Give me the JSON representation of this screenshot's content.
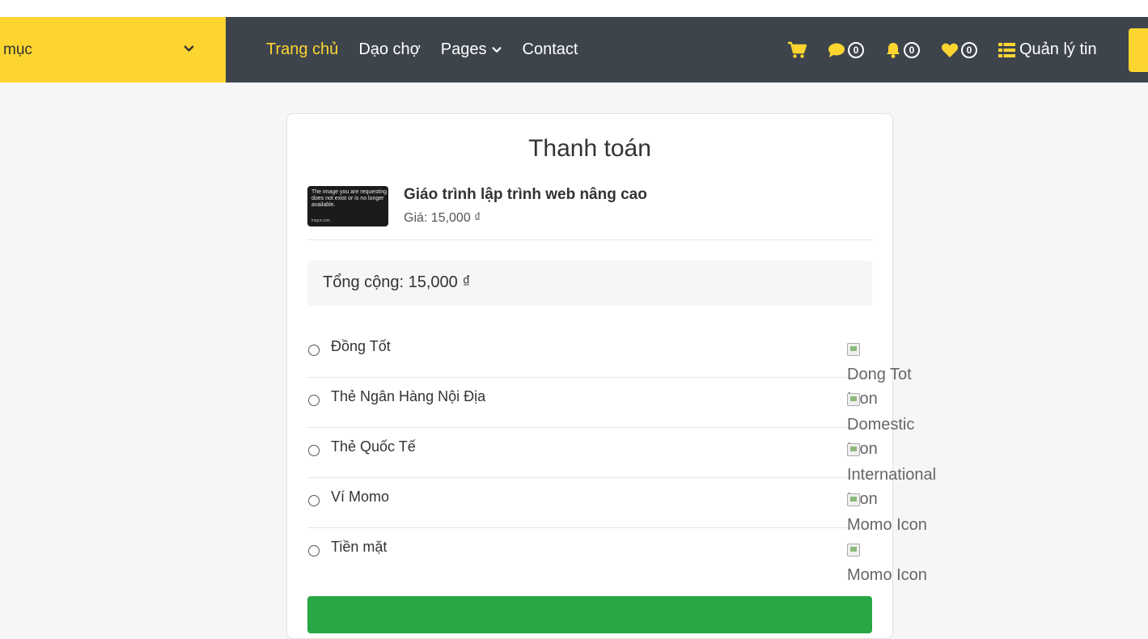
{
  "header": {
    "category_label": "mục",
    "nav": [
      {
        "label": "Trang chủ",
        "active": true
      },
      {
        "label": "Dạo chợ",
        "active": false
      },
      {
        "label": "Pages",
        "active": false,
        "has_dropdown": true
      },
      {
        "label": "Contact",
        "active": false
      }
    ],
    "counts": {
      "messages": "0",
      "notifications": "0",
      "favorites": "0"
    },
    "manage_label": "Quản lý tin"
  },
  "checkout": {
    "title": "Thanh toán",
    "product": {
      "placeholder_text": "The image you are requesting does not exist or is no longer available.",
      "placeholder_site": "imgur.com",
      "name": "Giáo trình lập trình web nâng cao",
      "price": "Giá: 15,000 ₫"
    },
    "total": "Tổng cộng: 15,000 ₫",
    "methods": [
      {
        "label": "Đồng Tốt",
        "icon_alt": "Dong Tot Icon"
      },
      {
        "label": "Thẻ Ngân Hàng Nội Địa",
        "icon_alt": "Domestic Icon"
      },
      {
        "label": "Thẻ Quốc Tế",
        "icon_alt": "International Icon"
      },
      {
        "label": "Ví Momo",
        "icon_alt": "Momo Icon"
      },
      {
        "label": "Tiền mặt",
        "icon_alt": "Momo Icon"
      }
    ]
  },
  "colors": {
    "accent": "#fdd531",
    "navbar": "#3d444c",
    "submit": "#28a745"
  }
}
